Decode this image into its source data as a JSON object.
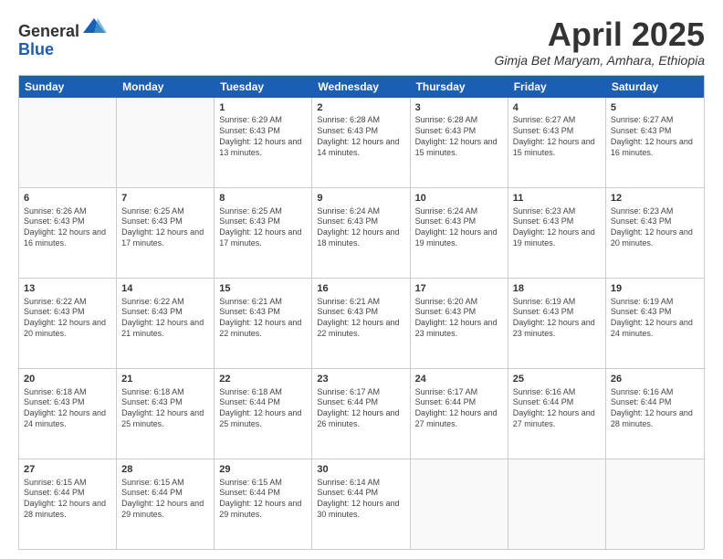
{
  "logo": {
    "general": "General",
    "blue": "Blue"
  },
  "title": "April 2025",
  "location": "Gimja Bet Maryam, Amhara, Ethiopia",
  "days": [
    "Sunday",
    "Monday",
    "Tuesday",
    "Wednesday",
    "Thursday",
    "Friday",
    "Saturday"
  ],
  "rows": [
    [
      {
        "day": "",
        "sunrise": "",
        "sunset": "",
        "daylight": ""
      },
      {
        "day": "",
        "sunrise": "",
        "sunset": "",
        "daylight": ""
      },
      {
        "day": "1",
        "sunrise": "Sunrise: 6:29 AM",
        "sunset": "Sunset: 6:43 PM",
        "daylight": "Daylight: 12 hours and 13 minutes."
      },
      {
        "day": "2",
        "sunrise": "Sunrise: 6:28 AM",
        "sunset": "Sunset: 6:43 PM",
        "daylight": "Daylight: 12 hours and 14 minutes."
      },
      {
        "day": "3",
        "sunrise": "Sunrise: 6:28 AM",
        "sunset": "Sunset: 6:43 PM",
        "daylight": "Daylight: 12 hours and 15 minutes."
      },
      {
        "day": "4",
        "sunrise": "Sunrise: 6:27 AM",
        "sunset": "Sunset: 6:43 PM",
        "daylight": "Daylight: 12 hours and 15 minutes."
      },
      {
        "day": "5",
        "sunrise": "Sunrise: 6:27 AM",
        "sunset": "Sunset: 6:43 PM",
        "daylight": "Daylight: 12 hours and 16 minutes."
      }
    ],
    [
      {
        "day": "6",
        "sunrise": "Sunrise: 6:26 AM",
        "sunset": "Sunset: 6:43 PM",
        "daylight": "Daylight: 12 hours and 16 minutes."
      },
      {
        "day": "7",
        "sunrise": "Sunrise: 6:25 AM",
        "sunset": "Sunset: 6:43 PM",
        "daylight": "Daylight: 12 hours and 17 minutes."
      },
      {
        "day": "8",
        "sunrise": "Sunrise: 6:25 AM",
        "sunset": "Sunset: 6:43 PM",
        "daylight": "Daylight: 12 hours and 17 minutes."
      },
      {
        "day": "9",
        "sunrise": "Sunrise: 6:24 AM",
        "sunset": "Sunset: 6:43 PM",
        "daylight": "Daylight: 12 hours and 18 minutes."
      },
      {
        "day": "10",
        "sunrise": "Sunrise: 6:24 AM",
        "sunset": "Sunset: 6:43 PM",
        "daylight": "Daylight: 12 hours and 19 minutes."
      },
      {
        "day": "11",
        "sunrise": "Sunrise: 6:23 AM",
        "sunset": "Sunset: 6:43 PM",
        "daylight": "Daylight: 12 hours and 19 minutes."
      },
      {
        "day": "12",
        "sunrise": "Sunrise: 6:23 AM",
        "sunset": "Sunset: 6:43 PM",
        "daylight": "Daylight: 12 hours and 20 minutes."
      }
    ],
    [
      {
        "day": "13",
        "sunrise": "Sunrise: 6:22 AM",
        "sunset": "Sunset: 6:43 PM",
        "daylight": "Daylight: 12 hours and 20 minutes."
      },
      {
        "day": "14",
        "sunrise": "Sunrise: 6:22 AM",
        "sunset": "Sunset: 6:43 PM",
        "daylight": "Daylight: 12 hours and 21 minutes."
      },
      {
        "day": "15",
        "sunrise": "Sunrise: 6:21 AM",
        "sunset": "Sunset: 6:43 PM",
        "daylight": "Daylight: 12 hours and 22 minutes."
      },
      {
        "day": "16",
        "sunrise": "Sunrise: 6:21 AM",
        "sunset": "Sunset: 6:43 PM",
        "daylight": "Daylight: 12 hours and 22 minutes."
      },
      {
        "day": "17",
        "sunrise": "Sunrise: 6:20 AM",
        "sunset": "Sunset: 6:43 PM",
        "daylight": "Daylight: 12 hours and 23 minutes."
      },
      {
        "day": "18",
        "sunrise": "Sunrise: 6:19 AM",
        "sunset": "Sunset: 6:43 PM",
        "daylight": "Daylight: 12 hours and 23 minutes."
      },
      {
        "day": "19",
        "sunrise": "Sunrise: 6:19 AM",
        "sunset": "Sunset: 6:43 PM",
        "daylight": "Daylight: 12 hours and 24 minutes."
      }
    ],
    [
      {
        "day": "20",
        "sunrise": "Sunrise: 6:18 AM",
        "sunset": "Sunset: 6:43 PM",
        "daylight": "Daylight: 12 hours and 24 minutes."
      },
      {
        "day": "21",
        "sunrise": "Sunrise: 6:18 AM",
        "sunset": "Sunset: 6:43 PM",
        "daylight": "Daylight: 12 hours and 25 minutes."
      },
      {
        "day": "22",
        "sunrise": "Sunrise: 6:18 AM",
        "sunset": "Sunset: 6:44 PM",
        "daylight": "Daylight: 12 hours and 25 minutes."
      },
      {
        "day": "23",
        "sunrise": "Sunrise: 6:17 AM",
        "sunset": "Sunset: 6:44 PM",
        "daylight": "Daylight: 12 hours and 26 minutes."
      },
      {
        "day": "24",
        "sunrise": "Sunrise: 6:17 AM",
        "sunset": "Sunset: 6:44 PM",
        "daylight": "Daylight: 12 hours and 27 minutes."
      },
      {
        "day": "25",
        "sunrise": "Sunrise: 6:16 AM",
        "sunset": "Sunset: 6:44 PM",
        "daylight": "Daylight: 12 hours and 27 minutes."
      },
      {
        "day": "26",
        "sunrise": "Sunrise: 6:16 AM",
        "sunset": "Sunset: 6:44 PM",
        "daylight": "Daylight: 12 hours and 28 minutes."
      }
    ],
    [
      {
        "day": "27",
        "sunrise": "Sunrise: 6:15 AM",
        "sunset": "Sunset: 6:44 PM",
        "daylight": "Daylight: 12 hours and 28 minutes."
      },
      {
        "day": "28",
        "sunrise": "Sunrise: 6:15 AM",
        "sunset": "Sunset: 6:44 PM",
        "daylight": "Daylight: 12 hours and 29 minutes."
      },
      {
        "day": "29",
        "sunrise": "Sunrise: 6:15 AM",
        "sunset": "Sunset: 6:44 PM",
        "daylight": "Daylight: 12 hours and 29 minutes."
      },
      {
        "day": "30",
        "sunrise": "Sunrise: 6:14 AM",
        "sunset": "Sunset: 6:44 PM",
        "daylight": "Daylight: 12 hours and 30 minutes."
      },
      {
        "day": "",
        "sunrise": "",
        "sunset": "",
        "daylight": ""
      },
      {
        "day": "",
        "sunrise": "",
        "sunset": "",
        "daylight": ""
      },
      {
        "day": "",
        "sunrise": "",
        "sunset": "",
        "daylight": ""
      }
    ]
  ]
}
